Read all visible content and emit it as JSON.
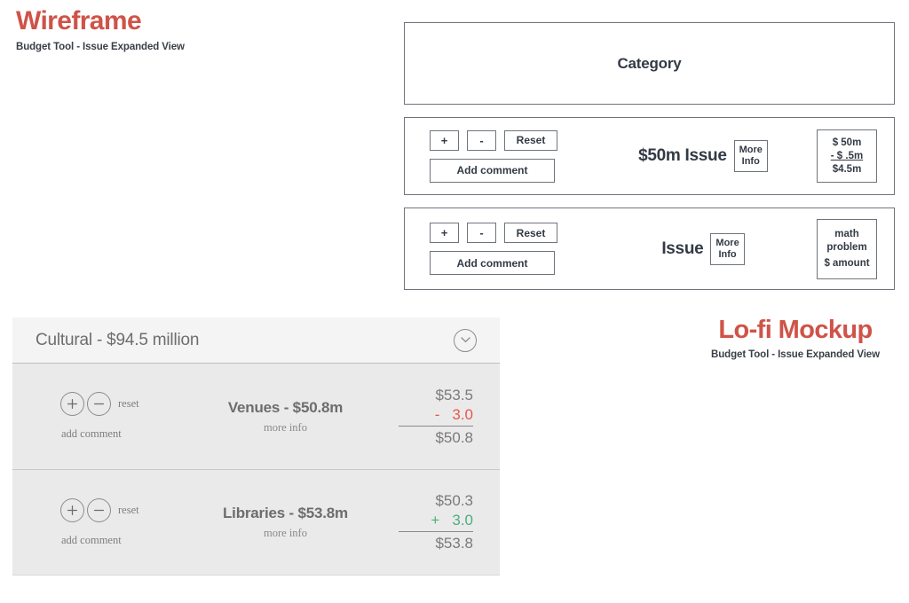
{
  "wireframe_header": {
    "title": "Wireframe",
    "subtitle": "Budget Tool - Issue Expanded View"
  },
  "lofi_header": {
    "title": "Lo-fi Mockup",
    "subtitle": "Budget Tool - Issue Expanded View"
  },
  "colors": {
    "accent_red": "#cf5348",
    "wireframe_stroke": "#6f747c",
    "wireframe_text": "#333a45",
    "mockup_text": "#6d6d6d",
    "mockup_muted": "#8a8a8a",
    "panel_row_bg": "#eaeaea",
    "panel_header_bg": "#f4f4f4",
    "negative_red": "#e8574a",
    "positive_green": "#4caf7d"
  },
  "wireframe": {
    "category_label": "Category",
    "issues": [
      {
        "plus_label": "+",
        "minus_label": "-",
        "reset_label": "Reset",
        "add_comment_label": "Add comment",
        "title": "$50m Issue",
        "more_info_line1": "More",
        "more_info_line2": "Info",
        "math": {
          "line1": "$ 50m",
          "line2": "- $ .5m",
          "line3": "$4.5m"
        }
      },
      {
        "plus_label": "+",
        "minus_label": "-",
        "reset_label": "Reset",
        "add_comment_label": "Add comment",
        "title": "Issue",
        "more_info_line1": "More",
        "more_info_line2": "Info",
        "math": {
          "line1": "math",
          "line2": "problem",
          "line3": "$ amount"
        }
      }
    ]
  },
  "mockup": {
    "category_title": "Cultural - $94.5 million",
    "collapse_icon": "chevron-down-icon",
    "rows": [
      {
        "plus_label": "+",
        "minus_label": "−",
        "reset_label": "reset",
        "add_comment_label": "add comment",
        "title": "Venues - $50.8m",
        "more_info_label": "more info",
        "math": {
          "base": "$53.5",
          "operator": "-",
          "delta": "3.0",
          "total": "$50.8",
          "delta_color": "#e8574a"
        }
      },
      {
        "plus_label": "+",
        "minus_label": "−",
        "reset_label": "reset",
        "add_comment_label": "add comment",
        "title": "Libraries - $53.8m",
        "more_info_label": "more info",
        "math": {
          "base": "$50.3",
          "operator": "+",
          "delta": "3.0",
          "total": "$53.8",
          "delta_color": "#4caf7d"
        }
      }
    ]
  }
}
